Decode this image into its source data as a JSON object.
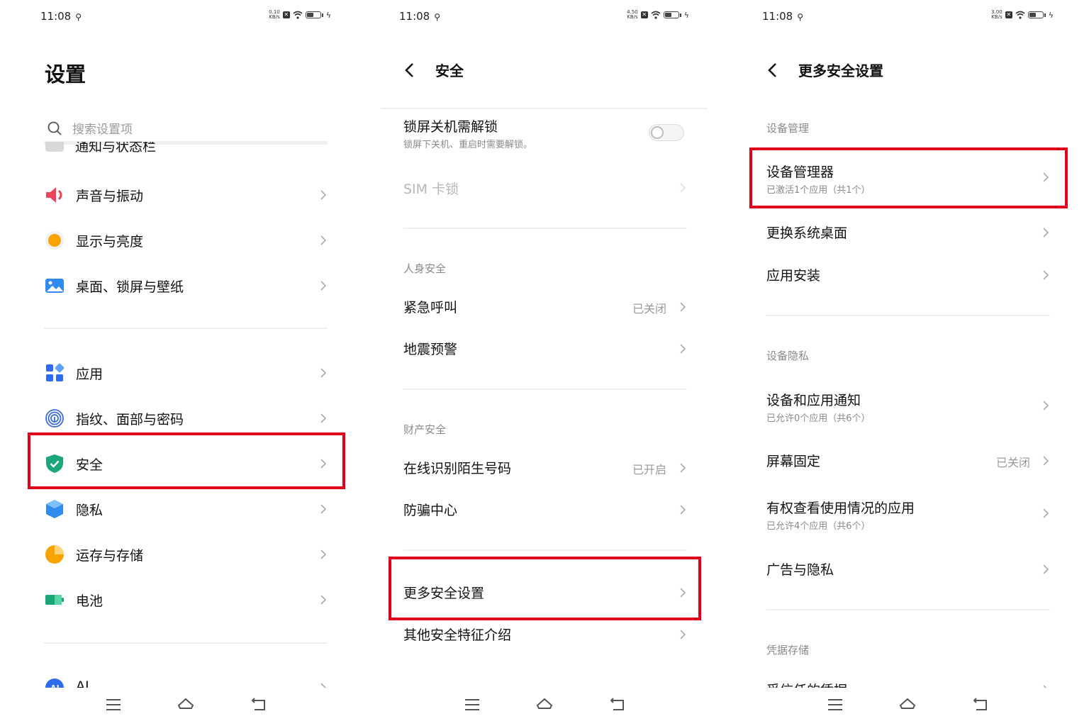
{
  "status_bar": [
    {
      "time": "11:08",
      "speed": "0.10",
      "unit": "KB/s"
    },
    {
      "time": "11:08",
      "speed": "4.50",
      "unit": "KB/s"
    },
    {
      "time": "11:08",
      "speed": "3.00",
      "unit": "KB/s"
    }
  ],
  "panel1": {
    "title": "设置",
    "search_placeholder": "搜索设置项",
    "cut_item": "通知与状态栏",
    "items": [
      {
        "label": "声音与振动",
        "icon": "speaker-icon"
      },
      {
        "label": "显示与亮度",
        "icon": "brightness-icon"
      },
      {
        "label": "桌面、锁屏与壁纸",
        "icon": "wallpaper-icon"
      },
      {
        "label": "应用",
        "icon": "apps-icon"
      },
      {
        "label": "指纹、面部与密码",
        "icon": "fingerprint-icon"
      },
      {
        "label": "安全",
        "icon": "shield-icon"
      },
      {
        "label": "隐私",
        "icon": "privacy-icon"
      },
      {
        "label": "运存与存储",
        "icon": "storage-icon"
      },
      {
        "label": "电池",
        "icon": "battery-icon"
      },
      {
        "label": "AI",
        "icon": "ai-icon"
      }
    ]
  },
  "panel2": {
    "title": "安全",
    "lock_title": "锁屏关机需解锁",
    "lock_sub": "锁屏下关机、重启时需要解锁。",
    "sim_lock": "SIM 卡锁",
    "section_personal": "人身安全",
    "emergency": "紧急呼叫",
    "emergency_status": "已关闭",
    "earthquake": "地震预警",
    "section_property": "财产安全",
    "online_id": "在线识别陌生号码",
    "online_id_status": "已开启",
    "anti_fraud": "防骗中心",
    "more_security": "更多安全设置",
    "other_features": "其他安全特征介绍"
  },
  "panel3": {
    "title": "更多安全设置",
    "section_device_mgmt": "设备管理",
    "device_admin": "设备管理器",
    "device_admin_sub": "已激活1个应用（共1个）",
    "change_launcher": "更换系统桌面",
    "app_install": "应用安装",
    "section_device_privacy": "设备隐私",
    "notif_access": "设备和应用通知",
    "notif_access_sub": "已允许0个应用（共6个）",
    "screen_pin": "屏幕固定",
    "screen_pin_status": "已关闭",
    "usage_access": "有权查看使用情况的应用",
    "usage_access_sub": "已允许4个应用（共6个）",
    "ads_privacy": "广告与隐私",
    "section_credentials": "凭据存储",
    "trusted_creds": "受信任的凭据"
  },
  "colors": {
    "highlight": "#e0001b",
    "shield": "#1aa67a",
    "speaker": "#f0445a",
    "brightness": "#f7a400",
    "apps": "#2f6bef"
  },
  "nav_icons": [
    "menu-icon",
    "home-icon",
    "back-nav-icon"
  ]
}
